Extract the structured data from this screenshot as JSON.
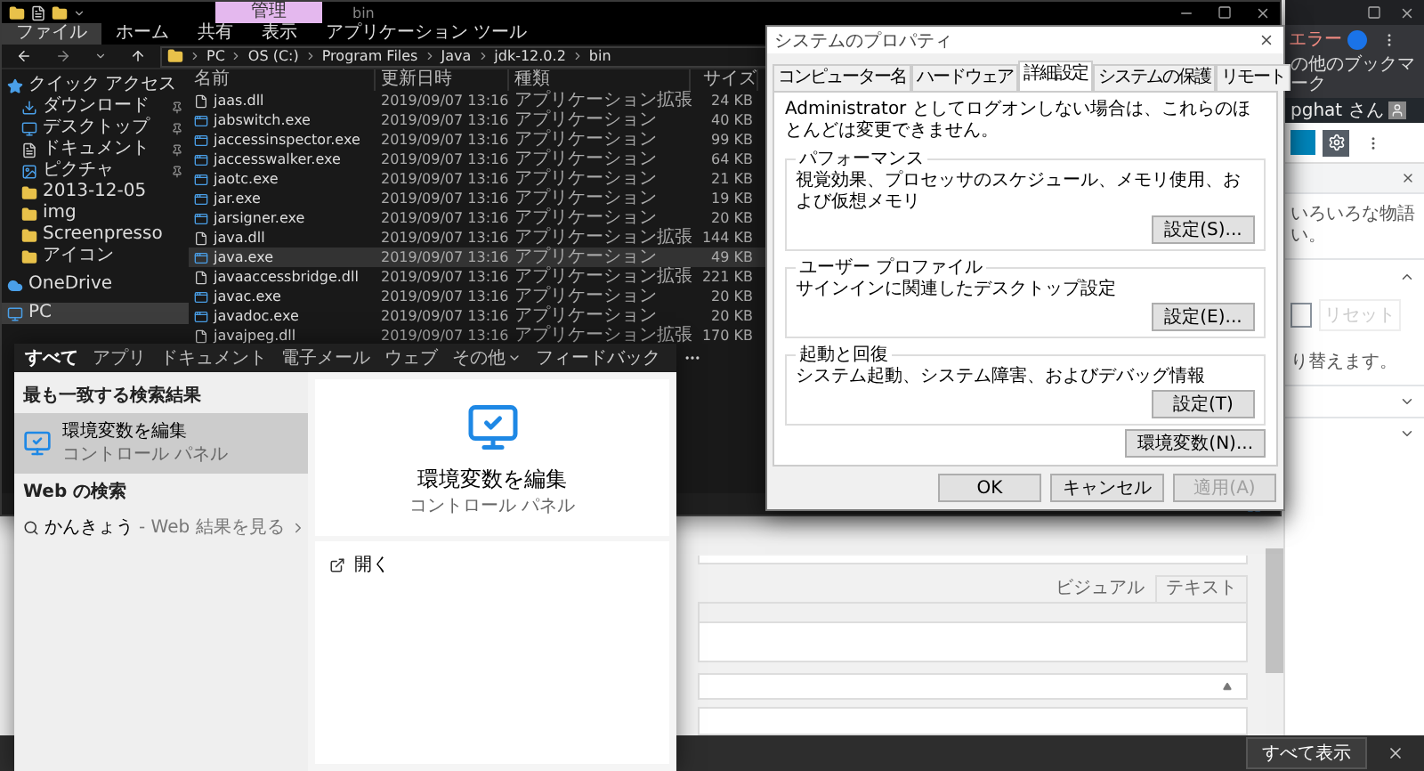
{
  "explorer": {
    "context_tab": "管理",
    "title": "bin",
    "ribbon_tabs": [
      {
        "label": "ファイル",
        "selected": true
      },
      {
        "label": "ホーム",
        "selected": false
      },
      {
        "label": "共有",
        "selected": false
      },
      {
        "label": "表示",
        "selected": false
      },
      {
        "label": "アプリケーション ツール",
        "selected": false
      }
    ],
    "breadcrumb": [
      "PC",
      "OS (C:)",
      "Program Files",
      "Java",
      "jdk-12.0.2",
      "bin"
    ],
    "sidebar": [
      {
        "label": "クイック アクセス",
        "kind": "star",
        "pinned": false,
        "selected": false,
        "children": [
          {
            "label": "ダウンロード",
            "kind": "download",
            "pinned": true,
            "selected": false
          },
          {
            "label": "デスクトップ",
            "kind": "desktop",
            "pinned": true,
            "selected": false
          },
          {
            "label": "ドキュメント",
            "kind": "document",
            "pinned": true,
            "selected": false
          },
          {
            "label": "ピクチャ",
            "kind": "picture",
            "pinned": true,
            "selected": false
          },
          {
            "label": "2013-12-05",
            "kind": "folder",
            "pinned": false,
            "selected": false
          },
          {
            "label": "img",
            "kind": "folder",
            "pinned": false,
            "selected": false
          },
          {
            "label": "Screenpresso",
            "kind": "folder",
            "pinned": false,
            "selected": false
          },
          {
            "label": "アイコン",
            "kind": "folder",
            "pinned": false,
            "selected": false
          }
        ]
      },
      {
        "label": "OneDrive",
        "kind": "cloud",
        "pinned": false,
        "selected": false
      },
      {
        "label": "PC",
        "kind": "pc",
        "pinned": false,
        "selected": true
      }
    ],
    "columns": [
      "名前",
      "更新日時",
      "種類",
      "サイズ"
    ],
    "files": [
      {
        "name": "jaas.dll",
        "modified": "2019/09/07 13:16",
        "type": "アプリケーション拡張",
        "size": "24 KB",
        "kind": "dll",
        "selected": false
      },
      {
        "name": "jabswitch.exe",
        "modified": "2019/09/07 13:16",
        "type": "アプリケーション",
        "size": "40 KB",
        "kind": "exe",
        "selected": false
      },
      {
        "name": "jaccessinspector.exe",
        "modified": "2019/09/07 13:16",
        "type": "アプリケーション",
        "size": "99 KB",
        "kind": "exe",
        "selected": false
      },
      {
        "name": "jaccesswalker.exe",
        "modified": "2019/09/07 13:16",
        "type": "アプリケーション",
        "size": "64 KB",
        "kind": "exe",
        "selected": false
      },
      {
        "name": "jaotc.exe",
        "modified": "2019/09/07 13:16",
        "type": "アプリケーション",
        "size": "21 KB",
        "kind": "exe",
        "selected": false
      },
      {
        "name": "jar.exe",
        "modified": "2019/09/07 13:16",
        "type": "アプリケーション",
        "size": "19 KB",
        "kind": "exe",
        "selected": false
      },
      {
        "name": "jarsigner.exe",
        "modified": "2019/09/07 13:16",
        "type": "アプリケーション",
        "size": "20 KB",
        "kind": "exe",
        "selected": false
      },
      {
        "name": "java.dll",
        "modified": "2019/09/07 13:16",
        "type": "アプリケーション拡張",
        "size": "144 KB",
        "kind": "dll",
        "selected": false
      },
      {
        "name": "java.exe",
        "modified": "2019/09/07 13:16",
        "type": "アプリケーション",
        "size": "49 KB",
        "kind": "exe",
        "selected": true
      },
      {
        "name": "javaaccessbridge.dll",
        "modified": "2019/09/07 13:16",
        "type": "アプリケーション拡張",
        "size": "221 KB",
        "kind": "dll",
        "selected": false
      },
      {
        "name": "javac.exe",
        "modified": "2019/09/07 13:16",
        "type": "アプリケーション",
        "size": "20 KB",
        "kind": "exe",
        "selected": false
      },
      {
        "name": "javadoc.exe",
        "modified": "2019/09/07 13:16",
        "type": "アプリケーション",
        "size": "20 KB",
        "kind": "exe",
        "selected": false
      },
      {
        "name": "javajpeg.dll",
        "modified": "2019/09/07 13:16",
        "type": "アプリケーション拡張",
        "size": "170 KB",
        "kind": "dll",
        "selected": false
      }
    ]
  },
  "dialog": {
    "title": "システムのプロパティ",
    "tabs": [
      {
        "label": "コンピューター名",
        "selected": false
      },
      {
        "label": "ハードウェア",
        "selected": false
      },
      {
        "label": "詳細設定",
        "selected": true
      },
      {
        "label": "システムの保護",
        "selected": false
      },
      {
        "label": "リモート",
        "selected": false
      }
    ],
    "notice": "Administrator としてログオンしない場合は、これらのほとんどは変更できません。",
    "groups": [
      {
        "title": "パフォーマンス",
        "description": "視覚効果、プロセッサのスケジュール、メモリ使用、および仮想メモリ",
        "button": "設定(S)..."
      },
      {
        "title": "ユーザー プロファイル",
        "description": "サインインに関連したデスクトップ設定",
        "button": "設定(E)..."
      },
      {
        "title": "起動と回復",
        "description": "システム起動、システム障害、およびデバッグ情報",
        "button": "設定(T)"
      }
    ],
    "env_button": "環境変数(N)...",
    "buttons": [
      {
        "label": "OK",
        "disabled": false
      },
      {
        "label": "キャンセル",
        "disabled": false
      },
      {
        "label": "適用(A)",
        "disabled": true
      }
    ]
  },
  "search": {
    "tabs": [
      {
        "label": "すべて",
        "selected": true,
        "has_menu": false
      },
      {
        "label": "アプリ",
        "selected": false,
        "has_menu": false
      },
      {
        "label": "ドキュメント",
        "selected": false,
        "has_menu": false
      },
      {
        "label": "電子メール",
        "selected": false,
        "has_menu": false
      },
      {
        "label": "ウェブ",
        "selected": false,
        "has_menu": false
      },
      {
        "label": "その他",
        "selected": false,
        "has_menu": true
      }
    ],
    "feedback": "フィードバック",
    "best_match_heading": "最も一致する検索結果",
    "best_match": {
      "title": "環境変数を編集",
      "subtitle": "コントロール パネル",
      "selected": true
    },
    "web_heading": "Web の検索",
    "web_result": {
      "query": "かんきょう",
      "hint": "- Web 結果を見る"
    },
    "preview": {
      "title": "環境変数を編集",
      "subtitle": "コントロール パネル",
      "actions": [
        "開く"
      ]
    }
  },
  "browser": {
    "error_label": "エラー",
    "bookmarks_folder": "の他のブックマーク",
    "user": "pghat さん",
    "notice_lines": [
      "いろいろな物語",
      "い。"
    ],
    "reset_button": {
      "label": "リセット",
      "disabled": true
    },
    "help_text": "り替えます。",
    "editor_tabs": [
      {
        "label": "ビジュアル",
        "selected": false
      },
      {
        "label": "テキスト",
        "selected": true
      }
    ],
    "download_bar": {
      "show_all": "すべて表示"
    }
  }
}
